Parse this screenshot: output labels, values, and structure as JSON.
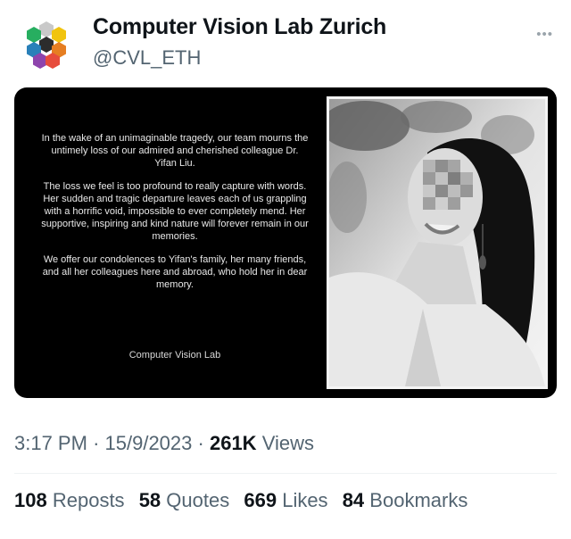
{
  "author": {
    "display_name": "Computer Vision Lab Zurich",
    "handle": "@CVL_ETH",
    "avatar_icon": "hexagon-cluster-logo"
  },
  "menu_icon": "more-dots-icon",
  "memorial_card": {
    "paragraphs": [
      "In the wake of an unimaginable tragedy, our team mourns the untimely loss of our admired and cherished colleague Dr. Yifan Liu.",
      "The loss we feel is too profound to really capture with words. Her sudden and tragic departure leaves each of us grappling with a horrific void, impossible to ever completely mend. Her supportive, inspiring and kind nature will forever remain in our memories.",
      "We offer our condolences to Yifan's family, her many friends, and all her colleagues here and abroad, who hold her in dear memory."
    ],
    "signature": "Computer Vision Lab"
  },
  "meta": {
    "time": "3:17 PM",
    "date": "15/9/2023",
    "views_count": "261K",
    "views_label": "Views",
    "sep": "·"
  },
  "stats": [
    {
      "count": "108",
      "label": "Reposts"
    },
    {
      "count": "58",
      "label": "Quotes"
    },
    {
      "count": "669",
      "label": "Likes"
    },
    {
      "count": "84",
      "label": "Bookmarks"
    }
  ],
  "colors": {
    "text_primary": "#0f1419",
    "text_secondary": "#536471",
    "card_background": "#000000",
    "logo": [
      "#f1c40f",
      "#e67e22",
      "#e74c3c",
      "#8e44ad",
      "#2980b9",
      "#27ae60",
      "#2c2c2c"
    ]
  }
}
